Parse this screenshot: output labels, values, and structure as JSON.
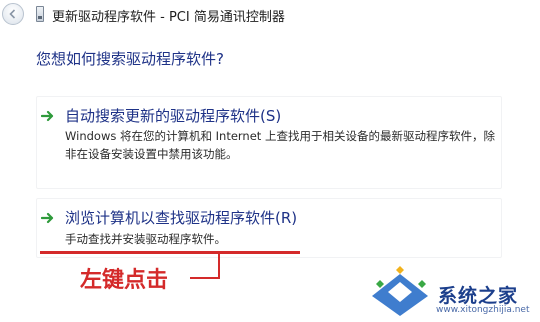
{
  "window": {
    "title": "更新驱动程序软件 - PCI 简易通讯控制器"
  },
  "main": {
    "question": "您想如何搜索驱动程序软件?",
    "options": [
      {
        "title": "自动搜索更新的驱动程序软件(S)",
        "description": "Windows 将在您的计算机和 Internet 上查找用于相关设备的最新驱动程序软件，除非在设备安装设置中禁用该功能。"
      },
      {
        "title": "浏览计算机以查找驱动程序软件(R)",
        "description": "手动查找并安装驱动程序软件。"
      }
    ]
  },
  "annotation": {
    "text": "左键点击",
    "color": "#d42a2a"
  },
  "watermark": {
    "brand": "系统之家",
    "url": "www.xitongzhijia.net"
  },
  "colors": {
    "link_blue": "#1e3287",
    "arrow_green": "#2e9a3b"
  }
}
